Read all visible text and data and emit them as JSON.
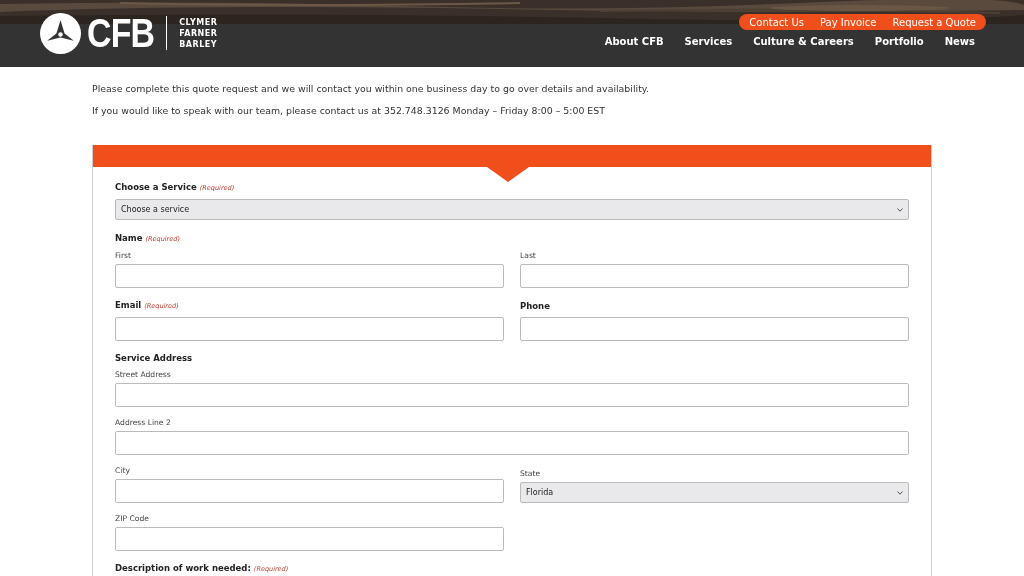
{
  "header": {
    "logo": {
      "mark": "CFB",
      "lines": [
        "CLYMER",
        "FARNER",
        "BARLEY"
      ]
    },
    "utility_links": [
      "Contact Us",
      "Pay Invoice",
      "Request a Quote"
    ],
    "nav": [
      "About CFB",
      "Services",
      "Culture & Careers",
      "Portfolio",
      "News"
    ]
  },
  "intro": [
    "Please complete this quote request and we will contact you within one business day to go over details and availability.",
    "If you would like to speak with our team, please contact us at 352.748.3126 Monday – Friday 8:00 – 5:00 EST"
  ],
  "form": {
    "sections": [
      {
        "kind": "select",
        "label": "Choose a Service",
        "note": "(Required)",
        "value": "Choose a service"
      },
      {
        "kind": "group",
        "label": "Name",
        "note": "(Required)",
        "fields": [
          {
            "kind": "text",
            "sublabel": "First"
          },
          {
            "kind": "text",
            "sublabel": "Last"
          }
        ]
      },
      {
        "kind": "columns",
        "items": [
          {
            "label": "Email",
            "note": "(Required)"
          },
          {
            "label": "Phone"
          }
        ]
      },
      {
        "kind": "group",
        "label": "Service Address",
        "fields": [
          {
            "kind": "wide",
            "sublabel": "Street Address"
          },
          {
            "kind": "wide",
            "sublabel": "Address Line 2"
          },
          {
            "kind": "text",
            "sublabel": "City"
          },
          {
            "kind": "select",
            "sublabel": "State",
            "value": "Florida"
          },
          {
            "kind": "text",
            "sublabel": "ZIP Code"
          }
        ]
      },
      {
        "kind": "textarea",
        "label": "Description of work needed:",
        "note": "(Required)"
      }
    ]
  }
}
